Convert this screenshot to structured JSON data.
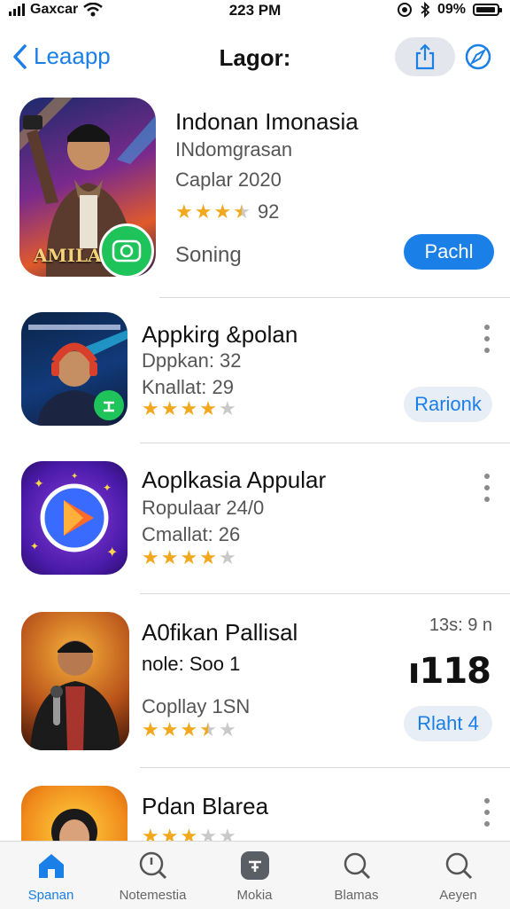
{
  "status_bar": {
    "carrier": "Gaxcar",
    "time": "223 PM",
    "battery": "09%"
  },
  "nav": {
    "back_label": "Leaapp",
    "title": "Lagor:"
  },
  "featured": {
    "name": "Indonan Imonasia",
    "developer": "INdomgrasan",
    "detail": "Caplar 2020",
    "rating": 3.5,
    "rating_value": "92",
    "status": "Soning",
    "button_label": "Pachl",
    "icon_text": "AMILAI"
  },
  "apps": [
    {
      "name": "Appkirg &polan",
      "line1": "Dppkan: 32",
      "line2": "Knallat: 29",
      "rating": 4,
      "button_label": "Rarionk"
    },
    {
      "name": "Aoplkasia Appular",
      "line1": "Ropulaar 24/0",
      "line2": "Cmallat: 26",
      "rating": 4
    },
    {
      "name": "A0fikan Pallisal",
      "line1": "nole: Soo 1",
      "line2": "Copllay 1SN",
      "rating": 3.5,
      "side_top": "13s: 9 n",
      "side_mid": "ı118",
      "button_label": "Rlaht 4"
    },
    {
      "name": "Pdan Blarea",
      "rating": 3
    }
  ],
  "tabs": [
    {
      "label": "Spanan",
      "icon": "home-icon"
    },
    {
      "label": "Notemestia",
      "icon": "search-icon"
    },
    {
      "label": "Mokia",
      "icon": "apps-icon"
    },
    {
      "label": "Blamas",
      "icon": "search-icon"
    },
    {
      "label": "Aeyen",
      "icon": "search-icon"
    }
  ],
  "colors": {
    "accent": "#1a7fe6",
    "star": "#f2a81d",
    "divider": "#d9d9d9"
  }
}
